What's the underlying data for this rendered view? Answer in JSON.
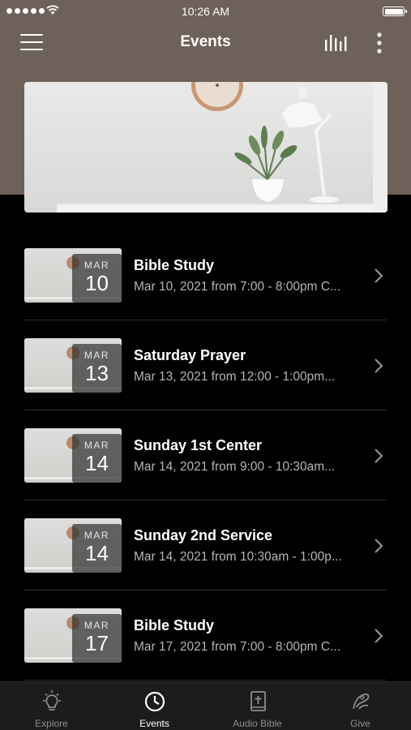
{
  "status_bar": {
    "time": "10:26 AM"
  },
  "nav": {
    "title": "Events"
  },
  "colors": {
    "header_bg": "#6e6159",
    "list_bg": "#000000",
    "tab_bg": "#1c1c1c",
    "subtext": "#b5b5b5"
  },
  "events": [
    {
      "month": "MAR",
      "day": "10",
      "title": "Bible Study",
      "subtitle": "Mar 10, 2021 from 7:00 - 8:00pm C..."
    },
    {
      "month": "MAR",
      "day": "13",
      "title": "Saturday Prayer",
      "subtitle": "Mar 13, 2021 from 12:00 - 1:00pm..."
    },
    {
      "month": "MAR",
      "day": "14",
      "title": "Sunday 1st Center",
      "subtitle": "Mar 14, 2021 from 9:00 - 10:30am..."
    },
    {
      "month": "MAR",
      "day": "14",
      "title": "Sunday 2nd Service",
      "subtitle": "Mar 14, 2021 from 10:30am - 1:00p..."
    },
    {
      "month": "MAR",
      "day": "17",
      "title": "Bible Study",
      "subtitle": "Mar 17, 2021 from 7:00 - 8:00pm C..."
    }
  ],
  "tabs": [
    {
      "label": "Explore",
      "icon": "lightbulb-icon",
      "active": false
    },
    {
      "label": "Events",
      "icon": "clock-icon",
      "active": true
    },
    {
      "label": "Audio Bible",
      "icon": "bible-icon",
      "active": false
    },
    {
      "label": "Give",
      "icon": "give-icon",
      "active": false
    }
  ]
}
